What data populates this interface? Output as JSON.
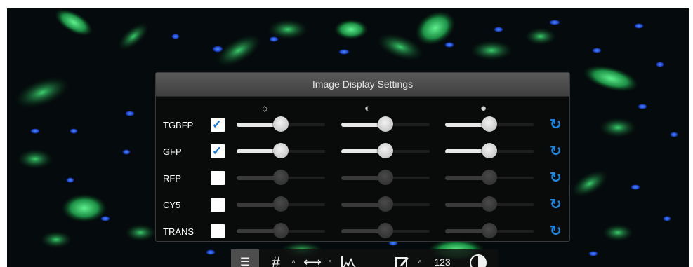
{
  "panel": {
    "title": "Image Display Settings",
    "column_icons": [
      "brightness-icon",
      "contrast-icon",
      "color-icon"
    ]
  },
  "channels": [
    {
      "name": "TGBFP",
      "checked": true,
      "brightness": 0.5,
      "contrast": 0.5,
      "color": 0.5
    },
    {
      "name": "GFP",
      "checked": true,
      "brightness": 0.5,
      "contrast": 0.5,
      "color": 0.5
    },
    {
      "name": "RFP",
      "checked": false,
      "brightness": 0.5,
      "contrast": 0.5,
      "color": 0.5
    },
    {
      "name": "CY5",
      "checked": false,
      "brightness": 0.5,
      "contrast": 0.5,
      "color": 0.5
    },
    {
      "name": "TRANS",
      "checked": false,
      "brightness": 0.5,
      "contrast": 0.5,
      "color": 0.5
    }
  ],
  "toolbar": {
    "items": [
      {
        "icon": "sliders-icon",
        "active": true
      },
      {
        "icon": "grid-icon",
        "active": false
      },
      {
        "icon": "ruler-icon",
        "active": false
      },
      {
        "icon": "histogram-icon",
        "active": false
      },
      {
        "icon": "annotate-icon",
        "active": false
      },
      {
        "icon": "contrast-toggle-icon",
        "active": false
      }
    ],
    "counter_label": "123"
  },
  "colors": {
    "accent": "#1d86e0",
    "panel_bg": "#0a0c0c",
    "cell_green": "#2fd16a",
    "nucleus_blue": "#1f4fd8"
  }
}
